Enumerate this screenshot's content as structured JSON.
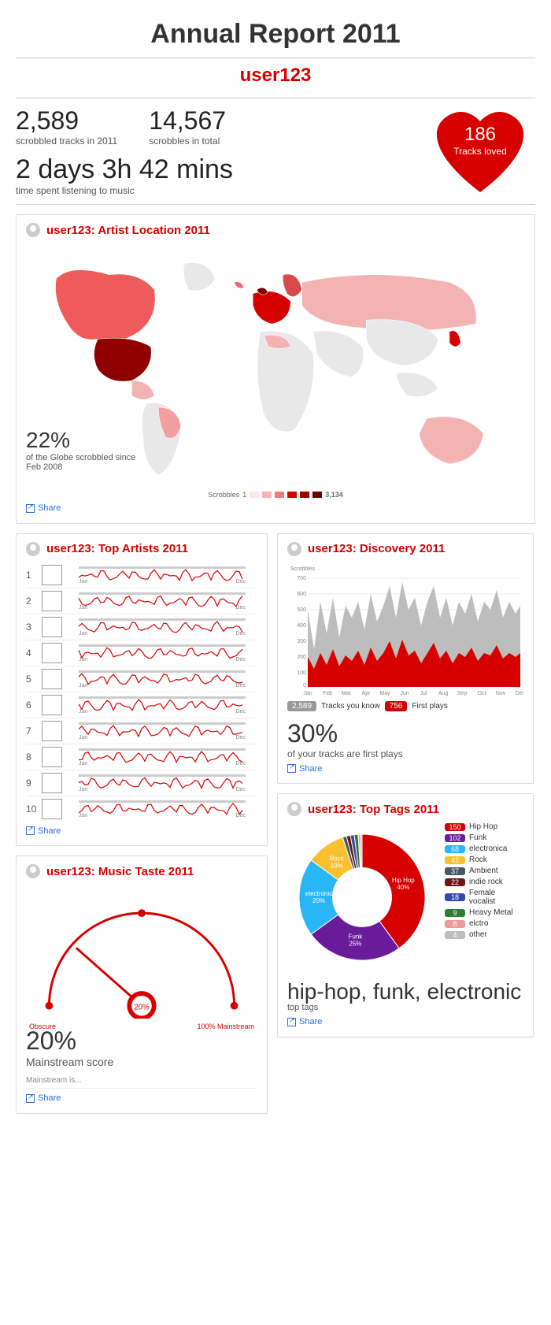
{
  "title": "Annual Report 2011",
  "username": "user123",
  "stats": {
    "scrobbled_2011": "2,589",
    "scrobbled_2011_label": "scrobbled tracks in 2011",
    "scrobbles_total": "14,567",
    "scrobbles_total_label": "scrobbles in total",
    "time_listening": "2 days 3h 42 mins",
    "time_listening_label": "time spent listening to music",
    "loved_count": "186",
    "loved_label": "Tracks loved"
  },
  "share_label": "Share",
  "map": {
    "title": "user123: Artist Location 2011",
    "pct": "22%",
    "pct_label": "of the Globe scrobbled since Feb 2008",
    "legend_label": "Scrobbles",
    "legend_min": "1",
    "legend_max": "3,134"
  },
  "top_artists": {
    "title": "user123: Top Artists 2011",
    "month_start": "Jan",
    "month_end": "Dec",
    "ranks": [
      "1",
      "2",
      "3",
      "4",
      "5",
      "6",
      "7",
      "8",
      "9",
      "10"
    ]
  },
  "discovery": {
    "title": "user123: Discovery 2011",
    "y_label": "Scrobbles",
    "months": [
      "Jan",
      "Feb",
      "Mar",
      "Apr",
      "May",
      "Jun",
      "Jul",
      "Aug",
      "Sep",
      "Oct",
      "Nov",
      "Dec"
    ],
    "known_count": "2,589",
    "known_label": "Tracks you know",
    "first_count": "756",
    "first_label": "First plays",
    "pct": "30%",
    "pct_label": "of your tracks are first plays"
  },
  "tags": {
    "title": "user123: Top Tags 2011",
    "items": [
      {
        "name": "Hip Hop",
        "count": "150",
        "color": "#d60000",
        "slice_label": "Hip Hop 40%",
        "pct": 40
      },
      {
        "name": "Funk",
        "count": "102",
        "color": "#6a1b9a",
        "slice_label": "Funk 25%",
        "pct": 25
      },
      {
        "name": "electronica",
        "count": "68",
        "color": "#29b6f6",
        "slice_label": "electronic 20%",
        "pct": 20
      },
      {
        "name": "Rock",
        "count": "42",
        "color": "#fbc02d",
        "slice_label": "Rock 10%",
        "pct": 10
      },
      {
        "name": "Ambient",
        "count": "37",
        "color": "#455a64",
        "pct": 1
      },
      {
        "name": "indie rock",
        "count": "22",
        "color": "#6d1313",
        "pct": 1
      },
      {
        "name": "Female vocalist",
        "count": "18",
        "color": "#3949ab",
        "pct": 1
      },
      {
        "name": "Heavy Metal",
        "count": "9",
        "color": "#2e7d32",
        "pct": 1
      },
      {
        "name": "elctro",
        "count": "8",
        "color": "#ef9a9a",
        "pct": 0.5
      },
      {
        "name": "other",
        "count": "4",
        "color": "#bdbdbd",
        "pct": 0.5
      }
    ],
    "summary": "hip-hop, funk, electronic",
    "summary_label": "top tags"
  },
  "taste": {
    "title": "user123: Music Taste 2011",
    "gauge_value": "20%",
    "left_label": "Obscure",
    "right_label": "100% Mainstream",
    "pct": "20%",
    "pct_label": "Mainstream score",
    "sub": "Mainstream is..."
  },
  "chart_data": {
    "top_tags_donut": {
      "type": "pie",
      "title": "user123: Top Tags 2011",
      "series": [
        {
          "name": "Hip Hop",
          "value": 150,
          "pct": 40
        },
        {
          "name": "Funk",
          "value": 102,
          "pct": 25
        },
        {
          "name": "electronica",
          "value": 68,
          "pct": 20
        },
        {
          "name": "Rock",
          "value": 42,
          "pct": 10
        },
        {
          "name": "Ambient",
          "value": 37
        },
        {
          "name": "indie rock",
          "value": 22
        },
        {
          "name": "Female vocalist",
          "value": 18
        },
        {
          "name": "Heavy Metal",
          "value": 9
        },
        {
          "name": "elctro",
          "value": 8
        },
        {
          "name": "other",
          "value": 4
        }
      ]
    },
    "discovery_area": {
      "type": "area",
      "title": "user123: Discovery 2011",
      "xlabel": "",
      "ylabel": "Scrobbles",
      "ylim": [
        0,
        700
      ],
      "x_months": [
        "Jan",
        "Feb",
        "Mar",
        "Apr",
        "May",
        "Jun",
        "Jul",
        "Aug",
        "Sep",
        "Oct",
        "Nov",
        "Dec"
      ],
      "series": [
        {
          "name": "Tracks you know",
          "total": 2589
        },
        {
          "name": "First plays",
          "total": 756
        }
      ],
      "note": "weekly resolution; values approximate from chart pixels"
    },
    "taste_gauge": {
      "type": "gauge",
      "value_pct": 20,
      "range": [
        "Obscure",
        "100% Mainstream"
      ]
    },
    "map_choropleth": {
      "type": "map",
      "scale_min": 1,
      "scale_max": 3134,
      "globe_pct_scrobbled": 22,
      "since": "Feb 2008"
    }
  }
}
